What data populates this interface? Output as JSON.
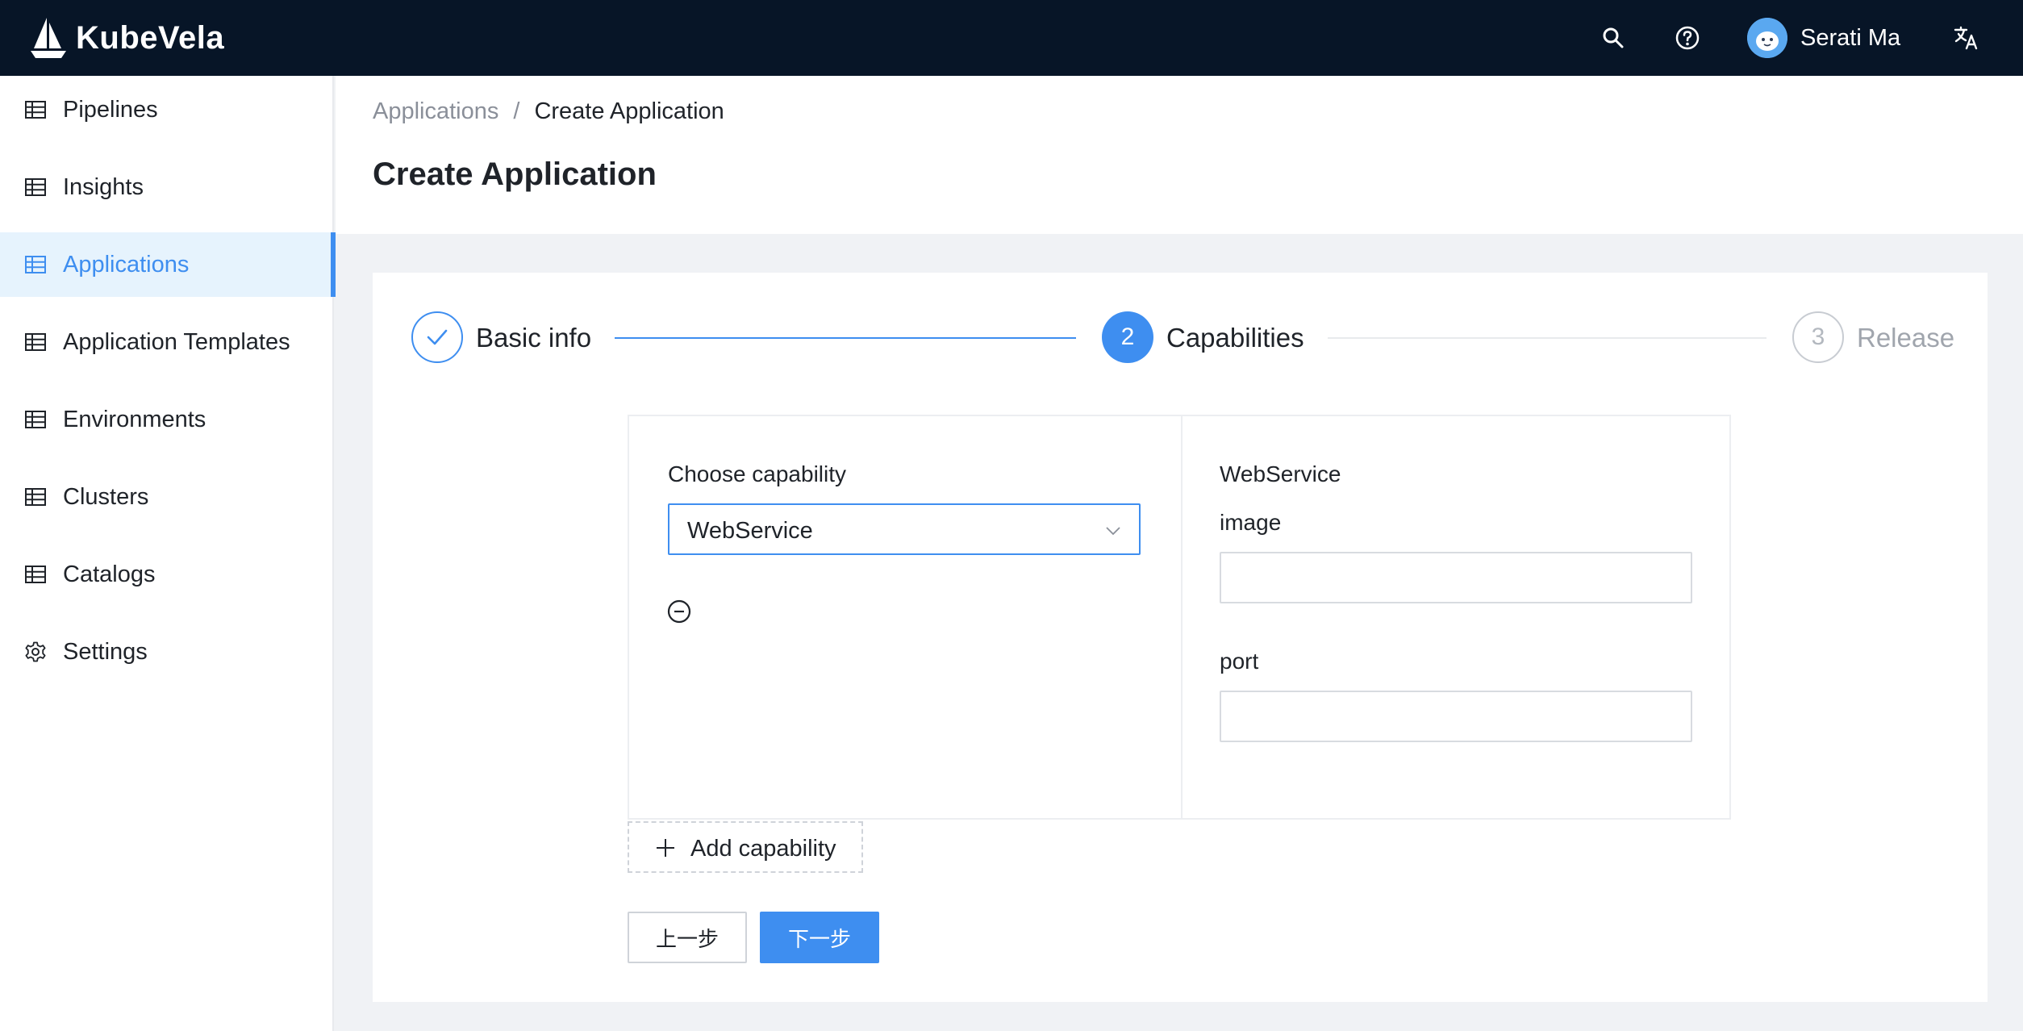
{
  "app": {
    "brand": "KubeVela",
    "accent_color": "#3e8ef0",
    "topbar_color": "#071527"
  },
  "topbar": {
    "search_icon": "search-icon",
    "help_icon": "help-circle-icon",
    "user_name": "Serati Ma",
    "language_icon": "translate-icon"
  },
  "sidebar": {
    "items": [
      {
        "label": "Pipelines",
        "icon": "table-icon",
        "active": false
      },
      {
        "label": "Insights",
        "icon": "table-icon",
        "active": false
      },
      {
        "label": "Applications",
        "icon": "table-icon",
        "active": true
      },
      {
        "label": "Application Templates",
        "icon": "table-icon",
        "active": false
      },
      {
        "label": "Environments",
        "icon": "table-icon",
        "active": false
      },
      {
        "label": "Clusters",
        "icon": "table-icon",
        "active": false
      },
      {
        "label": "Catalogs",
        "icon": "table-icon",
        "active": false
      },
      {
        "label": "Settings",
        "icon": "gear-icon",
        "active": false
      }
    ]
  },
  "header": {
    "breadcrumb": {
      "parent": "Applications",
      "separator": "/",
      "current": "Create Application"
    },
    "title": "Create Application"
  },
  "steps": [
    {
      "number": "1",
      "label": "Basic info",
      "status": "finished"
    },
    {
      "number": "2",
      "label": "Capabilities",
      "status": "process"
    },
    {
      "number": "3",
      "label": "Release",
      "status": "wait"
    }
  ],
  "capability": {
    "choose_label": "Choose capability",
    "selected": "WebService",
    "detail_title": "WebService",
    "fields": [
      {
        "label": "image",
        "value": ""
      },
      {
        "label": "port",
        "value": ""
      }
    ],
    "add_label": "Add capability"
  },
  "actions": {
    "prev_label": "上一步",
    "next_label": "下一步"
  }
}
